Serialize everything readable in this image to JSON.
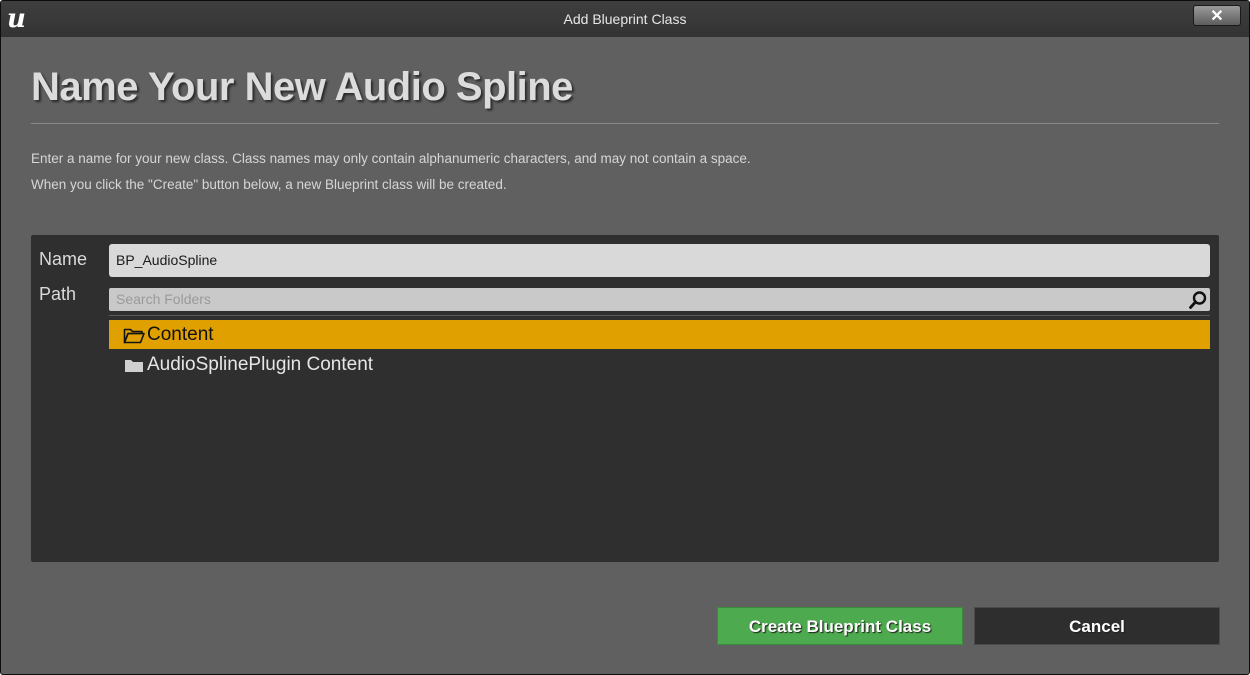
{
  "window": {
    "title": "Add Blueprint Class",
    "logo_text": "u",
    "close_label": "✕"
  },
  "header": {
    "title": "Name Your New Audio Spline"
  },
  "description": {
    "line1": "Enter a name for your new class. Class names may only contain alphanumeric characters, and may not contain a space.",
    "line2": "When you click the \"Create\" button below, a new Blueprint class will be created."
  },
  "form": {
    "name_label": "Name",
    "name_value": "BP_AudioSpline",
    "path_label": "Path",
    "search_placeholder": "Search Folders"
  },
  "folders": [
    {
      "label": "Content",
      "selected": true,
      "icon": "folder-open-icon"
    },
    {
      "label": "AudioSplinePlugin Content",
      "selected": false,
      "icon": "folder-icon"
    }
  ],
  "buttons": {
    "create": "Create Blueprint Class",
    "cancel": "Cancel"
  },
  "colors": {
    "selection": "#e0a000",
    "create_button": "#4eaa4e"
  }
}
